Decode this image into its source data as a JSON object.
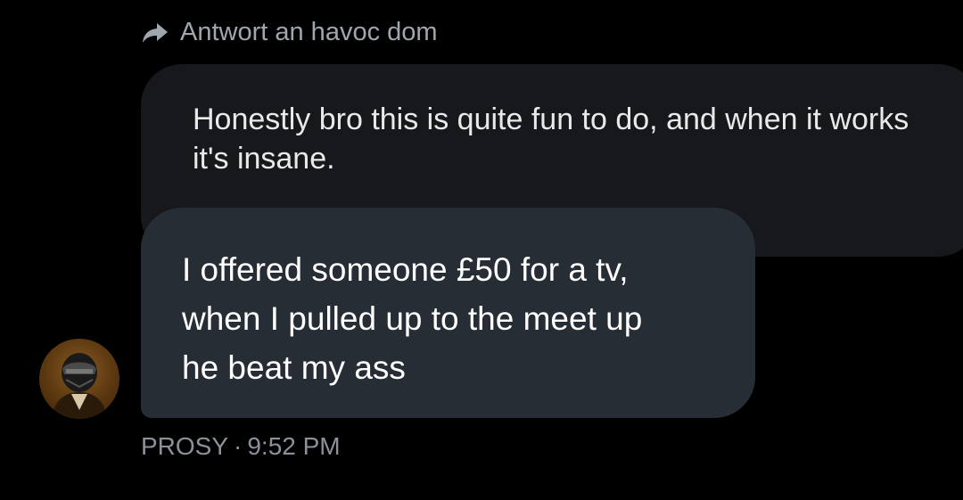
{
  "reply": {
    "icon": "reply-arrow-icon",
    "text": "Antwort an havoc dom"
  },
  "quoted_message": {
    "text": "Honestly bro this is quite fun to do, and when it works\nit's insane."
  },
  "message": {
    "text": "I offered someone £50 for a tv,\nwhen I pulled up to the meet up\nhe beat my ass"
  },
  "meta": {
    "sender": "PROSY",
    "separator": "·",
    "time": "9:52 PM"
  },
  "colors": {
    "background": "#000000",
    "quoted_bubble": "#16181c",
    "message_bubble": "#262d35",
    "secondary_text": "#8b9199"
  }
}
